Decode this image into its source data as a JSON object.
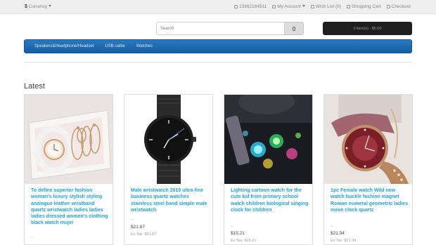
{
  "topbar": {
    "currency_symbol": "$",
    "currency_label": "Currency",
    "phone": "13962164511",
    "account": "My Account",
    "wishlist": "Wish List (0)",
    "cart": "Shopping Cart",
    "checkout": "Checkout"
  },
  "search": {
    "placeholder": "Search"
  },
  "cart_button": "0 item(s) - $0.00",
  "menu": [
    "Speakers&Headphone/Headset",
    "USB cable",
    "Watches"
  ],
  "section_title": "Latest",
  "products": [
    {
      "title": "To define superior fashion woman's luxury stylish styling analogue leather wristband quartz wristwatch ladies ladies ladies dressed women's clothing black watch mujer",
      "desc": "..",
      "price": "",
      "tax": ""
    },
    {
      "title": "Male wristwatch 2019 ultra-fine business quartz watches stainless steel band simple male wristwatch",
      "desc": "..",
      "price": "$21.87",
      "tax": "Ex Tax: $21.87"
    },
    {
      "title": "Lighting cartoon watch for the cute kid from primary school watch children biological singing clock for children",
      "desc": "..",
      "price": "$15.21",
      "tax": "Ex Tax: $15.21"
    },
    {
      "title": "1pc Female watch Wild new watch buckle fashion magnet Roman numeral geometric ladies move clock quartz",
      "desc": "..",
      "price": "$21.34",
      "tax": "Ex Tax: $21.34"
    }
  ]
}
